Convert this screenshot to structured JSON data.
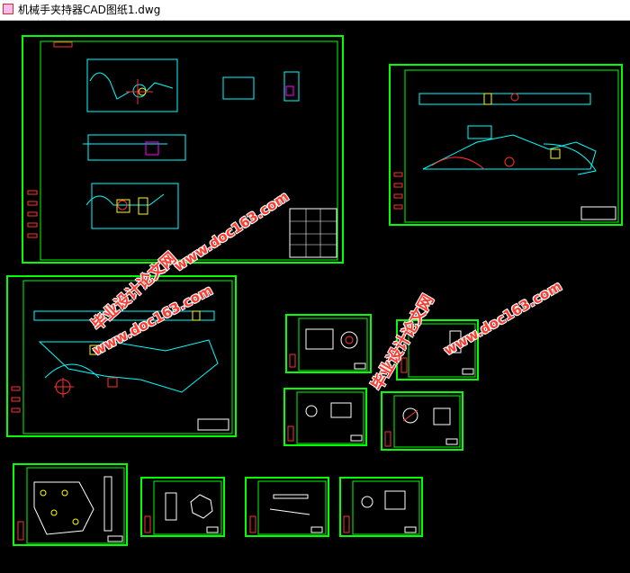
{
  "window": {
    "title": "机械手夹持器CAD图纸1.dwg"
  },
  "watermarks": [
    {
      "text": "www.doc163.com",
      "kind": "url"
    },
    {
      "text": "毕业设计论文网",
      "kind": "cn"
    },
    {
      "text": "www.doc163.com",
      "kind": "url"
    },
    {
      "text": "毕业设计论文网",
      "kind": "cn"
    },
    {
      "text": "www.doc163.com",
      "kind": "url"
    }
  ],
  "colors": {
    "frame": "#00ff00",
    "drawing": "#00ffff",
    "accent": "#ff00ff",
    "red": "#ff3030",
    "white": "#ffffff",
    "background": "#000000"
  },
  "sheets": [
    "assembly-drawing",
    "long-arm-part",
    "arm-assembly",
    "part-small-1",
    "part-small-2",
    "part-small-3",
    "part-small-4",
    "plate-part",
    "part-small-5",
    "part-small-6",
    "part-small-7"
  ]
}
